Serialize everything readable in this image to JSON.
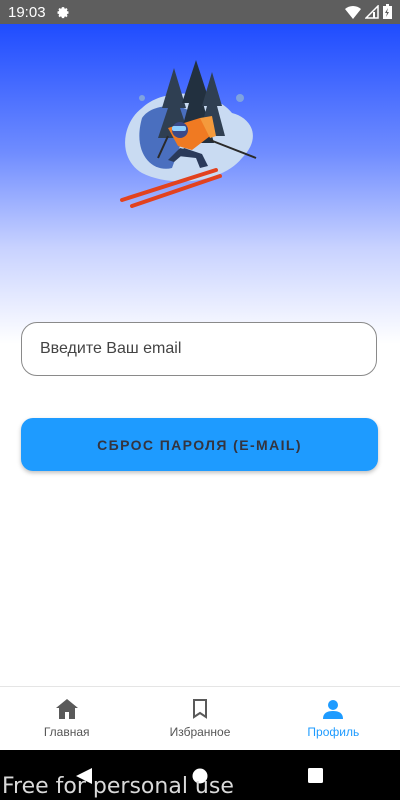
{
  "status_bar": {
    "time": "19:03",
    "icons": [
      "settings-gear-icon",
      "wifi-icon",
      "signal-icon",
      "battery-icon"
    ]
  },
  "hero": {
    "illustration": "skier-illustration",
    "gradient_colors": [
      "#1f4cff",
      "#ffffff"
    ]
  },
  "form": {
    "email_placeholder": "Введите Ваш email",
    "email_value": "",
    "reset_button_label": "СБРОС ПАРОЛЯ (E-MAIL)"
  },
  "bottom_nav": {
    "items": [
      {
        "label": "Главная",
        "icon": "home-icon",
        "active": false
      },
      {
        "label": "Избранное",
        "icon": "bookmark-icon",
        "active": false
      },
      {
        "label": "Профиль",
        "icon": "person-icon",
        "active": true
      }
    ]
  },
  "system_nav": {
    "buttons": [
      "back-icon",
      "home-circle-icon",
      "recents-icon"
    ]
  },
  "watermark": "Free for personal use",
  "colors": {
    "accent": "#1e9bff",
    "hero_top": "#1f4cff",
    "status_bar": "#5e5e5e"
  }
}
